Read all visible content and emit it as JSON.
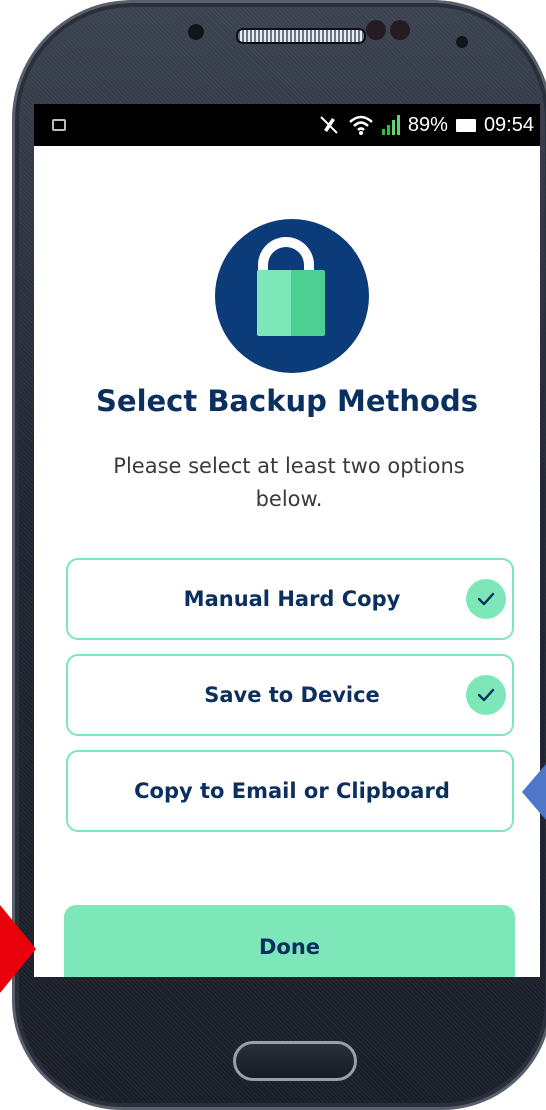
{
  "status_bar": {
    "battery_percent": "89%",
    "time": "09:54",
    "icons": [
      "image-icon",
      "mute-icon",
      "wifi-icon",
      "signal-icon",
      "battery-icon"
    ]
  },
  "header": {
    "icon": "lock-icon",
    "title": "Select Backup Methods",
    "subtitle": "Please select at least two options below."
  },
  "options": [
    {
      "label": "Manual Hard Copy",
      "selected": true
    },
    {
      "label": "Save to Device",
      "selected": true
    },
    {
      "label": "Copy to Email or Clipboard",
      "selected": false
    }
  ],
  "done_button": {
    "label": "Done"
  },
  "colors": {
    "brand_navy": "#0b2f5e",
    "lock_circle": "#0b3b78",
    "accent_mint": "#7ee7b9",
    "annotation_red": "#e8000b",
    "annotation_blue": "#4f77c9"
  }
}
